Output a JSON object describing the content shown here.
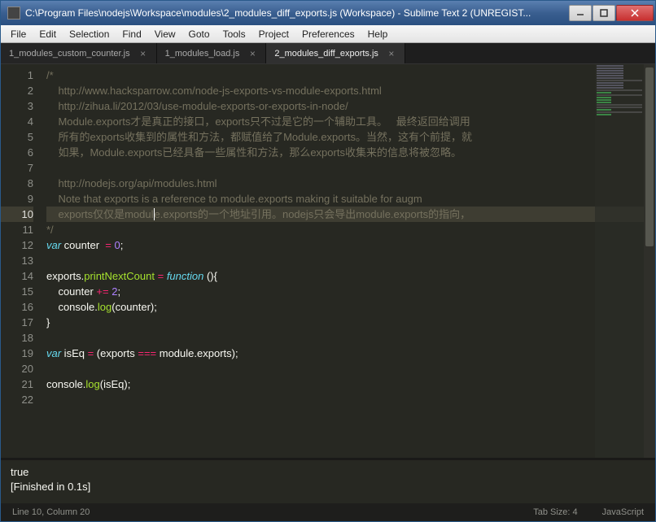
{
  "window": {
    "title": "C:\\Program Files\\nodejs\\Workspace\\modules\\2_modules_diff_exports.js (Workspace) - Sublime Text 2 (UNREGIST..."
  },
  "menu": [
    "File",
    "Edit",
    "Selection",
    "Find",
    "View",
    "Goto",
    "Tools",
    "Project",
    "Preferences",
    "Help"
  ],
  "tabs": [
    {
      "label": "1_modules_custom_counter.js",
      "active": false
    },
    {
      "label": "1_modules_load.js",
      "active": false
    },
    {
      "label": "2_modules_diff_exports.js",
      "active": true
    }
  ],
  "lines": [
    {
      "n": 1,
      "t": "comment",
      "txt": "/*"
    },
    {
      "n": 2,
      "t": "comment",
      "txt": "    http://www.hacksparrow.com/node-js-exports-vs-module-exports.html"
    },
    {
      "n": 3,
      "t": "comment",
      "txt": "    http://zihua.li/2012/03/use-module-exports-or-exports-in-node/"
    },
    {
      "n": 4,
      "t": "comment",
      "txt": "    Module.exports才是真正的接口，exports只不过是它的一个辅助工具。   最终返回给调用"
    },
    {
      "n": 5,
      "t": "comment",
      "txt": "    所有的exports收集到的属性和方法，都赋值给了Module.exports。当然，这有个前提，就"
    },
    {
      "n": 6,
      "t": "comment",
      "txt": "    如果，Module.exports已经具备一些属性和方法，那么exports收集来的信息将被忽略。"
    },
    {
      "n": 7,
      "t": "comment",
      "txt": ""
    },
    {
      "n": 8,
      "t": "comment",
      "txt": "    http://nodejs.org/api/modules.html"
    },
    {
      "n": 9,
      "t": "comment",
      "txt": "    Note that exports is a reference to module.exports making it suitable for augm"
    },
    {
      "n": 10,
      "t": "comment",
      "txt": "    exports仅仅是module.exports的一个地址引用。nodejs只会导出module.exports的指向，",
      "hl": true,
      "cursor": 19
    },
    {
      "n": 11,
      "t": "comment",
      "txt": "*/"
    },
    {
      "n": 12,
      "t": "code",
      "html": "<span class='k'>var</span> counter  <span class='o'>=</span> <span class='n'>0</span>;"
    },
    {
      "n": 13,
      "t": "code",
      "html": ""
    },
    {
      "n": 14,
      "t": "code",
      "html": "exports.<span class='s'>printNextCount</span> <span class='o'>=</span> <span class='k'>function</span> (){"
    },
    {
      "n": 15,
      "t": "code",
      "html": "    counter <span class='o'>+=</span> <span class='n'>2</span>;"
    },
    {
      "n": 16,
      "t": "code",
      "html": "    console.<span class='s'>log</span>(counter);"
    },
    {
      "n": 17,
      "t": "code",
      "html": "}"
    },
    {
      "n": 18,
      "t": "code",
      "html": ""
    },
    {
      "n": 19,
      "t": "code",
      "html": "<span class='k'>var</span> isEq <span class='o'>=</span> (exports <span class='o'>===</span> module.exports);"
    },
    {
      "n": 20,
      "t": "code",
      "html": ""
    },
    {
      "n": 21,
      "t": "code",
      "html": "console.<span class='s'>log</span>(isEq);"
    },
    {
      "n": 22,
      "t": "code",
      "html": ""
    }
  ],
  "console": {
    "line1": "true",
    "line2": "[Finished in 0.1s]"
  },
  "status": {
    "left": "Line 10, Column 20",
    "tab_size": "Tab Size: 4",
    "syntax": "JavaScript"
  }
}
